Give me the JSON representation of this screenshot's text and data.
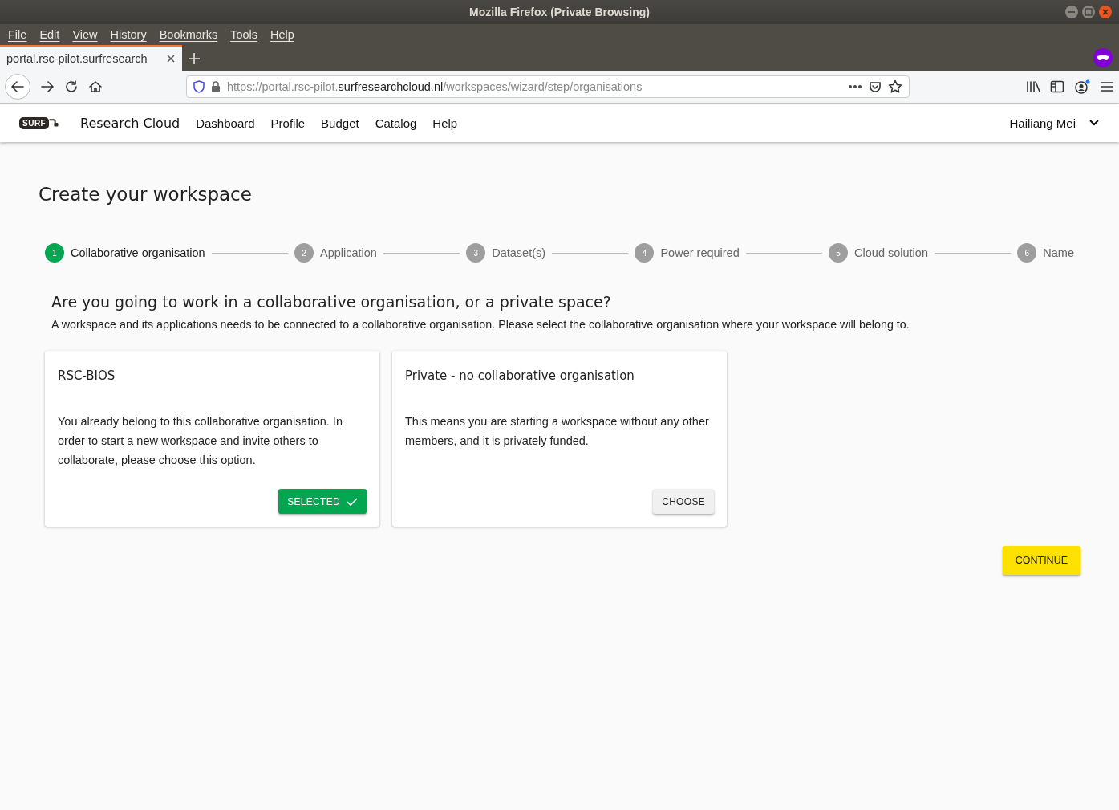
{
  "window": {
    "title": "Mozilla Firefox (Private Browsing)"
  },
  "menu": [
    "File",
    "Edit",
    "View",
    "History",
    "Bookmarks",
    "Tools",
    "Help"
  ],
  "tabs": [
    {
      "label": "portal.rsc-pilot.surfresearch",
      "selected": true
    }
  ],
  "address": {
    "prefix": "https://portal.rsc-pilot.",
    "domain": "surfresearchcloud.nl",
    "path": "/workspaces/wizard/step/organisations"
  },
  "header": {
    "logo": "SURF",
    "brand": "Research Cloud",
    "nav": [
      "Dashboard",
      "Profile",
      "Budget",
      "Catalog",
      "Help"
    ],
    "user": "Hailiang Mei"
  },
  "page": {
    "title": "Create your workspace",
    "steps": [
      {
        "number": "1",
        "label": "Collaborative organisation",
        "selected": true
      },
      {
        "number": "2",
        "label": "Application",
        "selected": false
      },
      {
        "number": "3",
        "label": "Dataset(s)",
        "selected": false
      },
      {
        "number": "4",
        "label": "Power required",
        "selected": false
      },
      {
        "number": "5",
        "label": "Cloud solution",
        "selected": false
      },
      {
        "number": "6",
        "label": "Name",
        "selected": false
      }
    ],
    "question": "Are you going to work in a collaborative organisation, or a private space?",
    "description": "A workspace and its applications needs to be connected to a collaborative organisation. Please select the collaborative organisation where your workspace will belong to.",
    "cards": [
      {
        "title": "RSC-BIOS",
        "text": "You already belong to this collaborative organisation. In order to start a new workspace and invite others to collaborate, please choose this option.",
        "button": "SELECTED",
        "selected": true
      },
      {
        "title": "Private - no collaborative organisation",
        "text": "This means you are starting a workspace without any other members, and it is privately funded.",
        "button": "CHOOSE",
        "selected": false
      }
    ],
    "continue": "CONTINUE"
  }
}
